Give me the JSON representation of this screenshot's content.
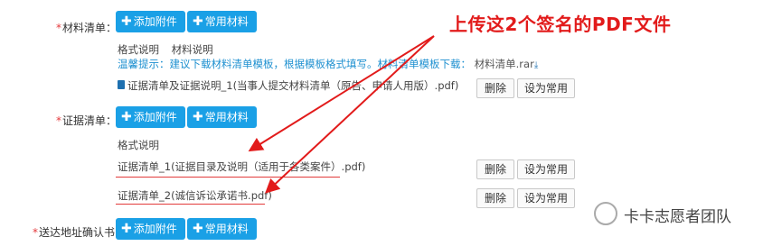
{
  "sections": {
    "materials": {
      "label_required": "*",
      "label": "材料清单：",
      "add_button": "添加附件",
      "common_button": "常用材料",
      "format_label": "格式说明",
      "format_value": "材料说明",
      "tip_prefix": "温馨提示：建议下载材料清单模板，根据模板格式填写。材料清单模板下载：",
      "tip_link": "材料清单.rar",
      "file_name": "证据清单及证据说明_1(当事人提交材料清单（原告、申请人用版）.pdf)",
      "delete_button": "删除",
      "set_common_button": "设为常用"
    },
    "evidence": {
      "label_required": "*",
      "label": "证据清单：",
      "add_button": "添加附件",
      "common_button": "常用材料",
      "format_label": "格式说明",
      "files": [
        {
          "name": "证据清单_1(证据目录及说明（适用于各类案件）.pdf)",
          "delete": "删除",
          "set_common": "设为常用"
        },
        {
          "name": "证据清单_2(诚信诉讼承诺书.pdf)",
          "delete": "删除",
          "set_common": "设为常用"
        }
      ]
    },
    "delivery": {
      "label_required": "*",
      "label": "送达地址确认书：",
      "add_button": "添加附件",
      "common_button": "常用材料"
    }
  },
  "annotation": {
    "text": "上传这2个签名的PDF文件",
    "color": "#e21b1b"
  },
  "watermark": {
    "text": "卡卡志愿者团队"
  },
  "colors": {
    "primary": "#1aa0e6",
    "link": "#1e90d0",
    "required": "#e4393c"
  }
}
